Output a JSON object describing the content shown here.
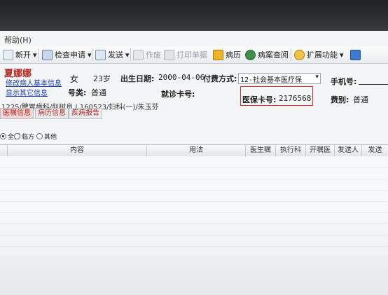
{
  "menu": {
    "help": "帮助(H)"
  },
  "toolbar": {
    "new": "新开",
    "exam_request": "检查申请",
    "send": "发送",
    "void": "作废",
    "print": "打印单据",
    "records": "病历",
    "record_query": "病案查阅",
    "extend": "扩展功能"
  },
  "patient": {
    "name": "夏娜娜",
    "edit_link": "修改病人基本信息",
    "other_info_link": "显示其它信息",
    "gender": "女",
    "age": "23岁",
    "dob_label": "出生日期:",
    "dob": "2000-04-06",
    "pay_label": "付费方式:",
    "pay_value": "12-社会基本医疗保",
    "phone_label": "手机号:",
    "category_label": "号类:",
    "category_value": "普通",
    "visit_card_label": "就诊卡号:",
    "insurance_label": "医保卡号:",
    "insurance_value": "2176568",
    "fee_label": "费别:",
    "fee_value": "普通",
    "history": "1225/脾胃病科/赵树良 | 160523/妇科(一)/朱玉芬"
  },
  "tabs": [
    "医嘱信息",
    "病历信息",
    "疾病报告"
  ],
  "filter": {
    "all": "全部",
    "short_term": "临方",
    "other": "其他"
  },
  "columns": [
    "内容",
    "用法",
    "医生嘱",
    "执行科",
    "开嘱医",
    "发送人",
    "发送"
  ],
  "colors": {
    "name": "#b3261e",
    "link": "#1a3fb0",
    "highlight_box": "#d9302c"
  }
}
